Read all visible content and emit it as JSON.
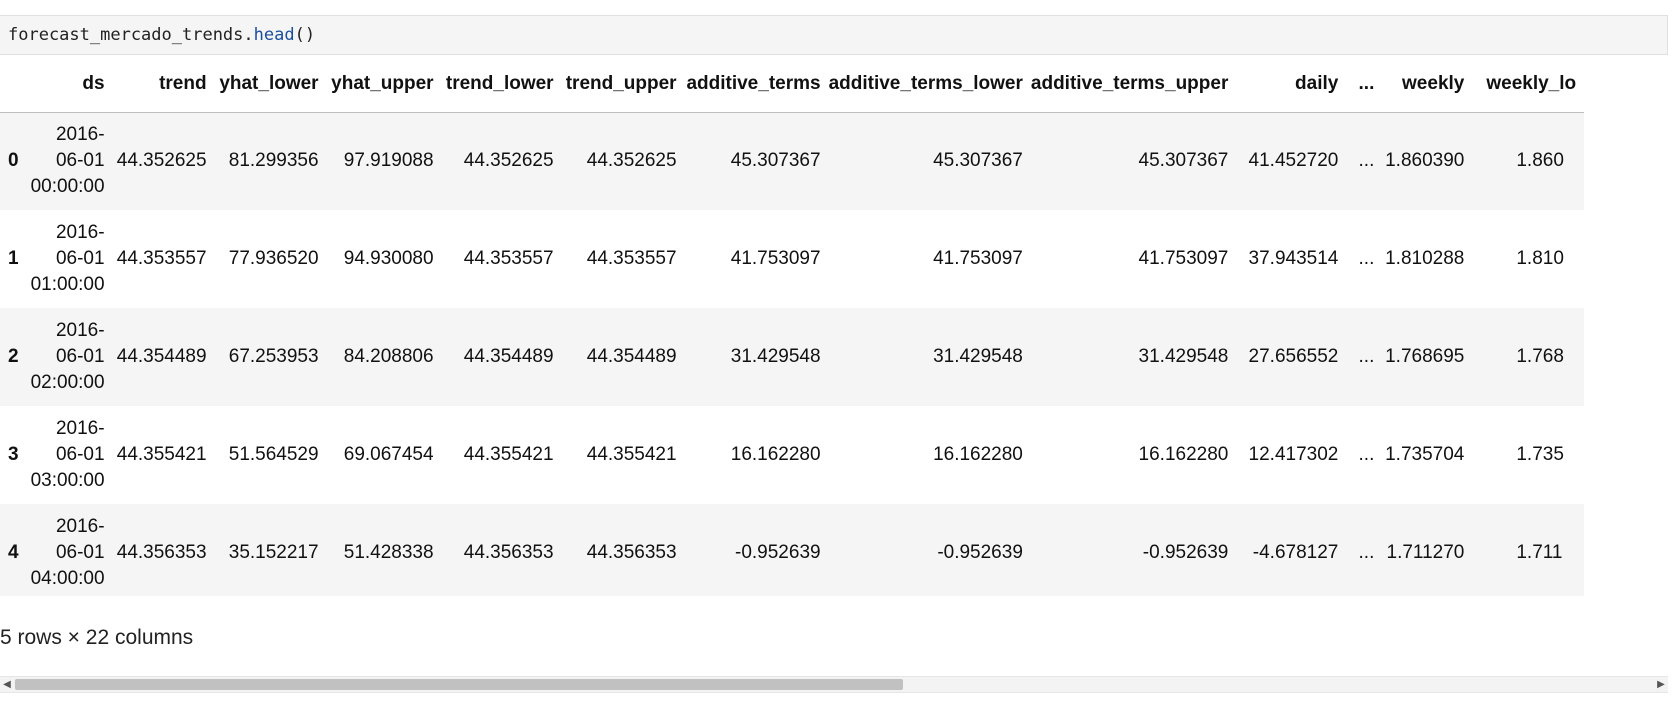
{
  "code_cell": {
    "prefix": "forecast_mercado_trends.",
    "method": "head",
    "suffix": "()"
  },
  "table": {
    "columns": [
      "ds",
      "trend",
      "yhat_lower",
      "yhat_upper",
      "trend_lower",
      "trend_upper",
      "additive_terms",
      "additive_terms_lower",
      "additive_terms_upper",
      "daily",
      "...",
      "weekly",
      "weekly_lo"
    ],
    "rows": [
      {
        "index": "0",
        "ds": [
          "2016-",
          "06-01",
          "00:00:00"
        ],
        "values": [
          "44.352625",
          "81.299356",
          "97.919088",
          "44.352625",
          "44.352625",
          "45.307367",
          "45.307367",
          "45.307367",
          "41.452720",
          "...",
          "1.860390",
          "1.860"
        ]
      },
      {
        "index": "1",
        "ds": [
          "2016-",
          "06-01",
          "01:00:00"
        ],
        "values": [
          "44.353557",
          "77.936520",
          "94.930080",
          "44.353557",
          "44.353557",
          "41.753097",
          "41.753097",
          "41.753097",
          "37.943514",
          "...",
          "1.810288",
          "1.810"
        ]
      },
      {
        "index": "2",
        "ds": [
          "2016-",
          "06-01",
          "02:00:00"
        ],
        "values": [
          "44.354489",
          "67.253953",
          "84.208806",
          "44.354489",
          "44.354489",
          "31.429548",
          "31.429548",
          "31.429548",
          "27.656552",
          "...",
          "1.768695",
          "1.768"
        ]
      },
      {
        "index": "3",
        "ds": [
          "2016-",
          "06-01",
          "03:00:00"
        ],
        "values": [
          "44.355421",
          "51.564529",
          "69.067454",
          "44.355421",
          "44.355421",
          "16.162280",
          "16.162280",
          "16.162280",
          "12.417302",
          "...",
          "1.735704",
          "1.735"
        ]
      },
      {
        "index": "4",
        "ds": [
          "2016-",
          "06-01",
          "04:00:00"
        ],
        "values": [
          "44.356353",
          "35.152217",
          "51.428338",
          "44.356353",
          "44.356353",
          "-0.952639",
          "-0.952639",
          "-0.952639",
          "-4.678127",
          "...",
          "1.711270",
          "1.711"
        ]
      }
    ]
  },
  "summary": "5 rows × 22 columns",
  "scrollbar": {
    "left_icon": "scroll-left-icon",
    "right_icon": "scroll-right-icon",
    "position": 0.0
  }
}
